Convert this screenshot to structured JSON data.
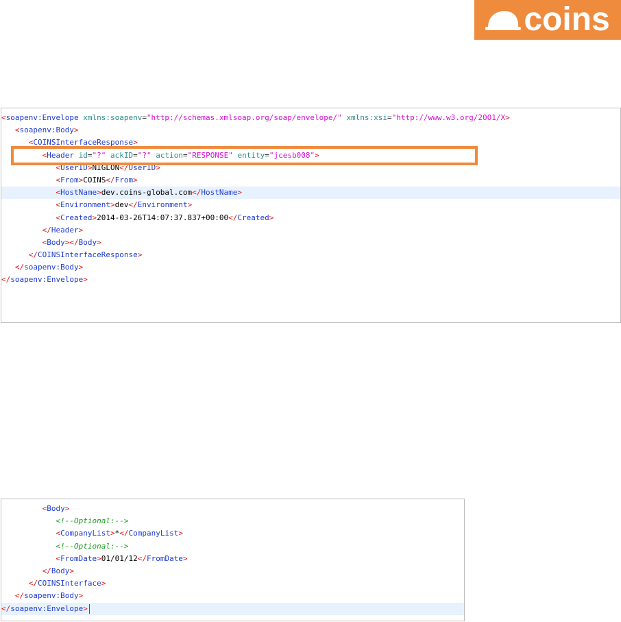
{
  "logo": {
    "text": "coins",
    "icon": "helmet-icon",
    "color": "#ef8b3d"
  },
  "top_panel": {
    "lines": [
      {
        "indent": "",
        "open": "soapenv:Envelope",
        "attrs": [
          [
            "xmlns:soapenv",
            "\"http://schemas.xmlsoap.org/soap/envelope/\""
          ],
          [
            "xmlns:xsi",
            "\"http://www.w3.org/2001/X"
          ]
        ]
      },
      {
        "indent": "   ",
        "open": "soapenv:Body"
      },
      {
        "indent": "      ",
        "open": "COINSInterfaceResponse"
      },
      {
        "indent": "         ",
        "open": "Header",
        "attrs": [
          [
            "id",
            "\"?\""
          ],
          [
            "ackID",
            "\"?\""
          ],
          [
            "action",
            "\"RESPONSE\""
          ],
          [
            "entity",
            "\"jcesb008\""
          ]
        ]
      },
      {
        "indent": "            ",
        "open": "UserID",
        "text": "NIGLON",
        "close": "UserID"
      },
      {
        "indent": "            ",
        "open": "From",
        "text": "COINS",
        "close": "From"
      },
      {
        "indent": "            ",
        "open": "HostName",
        "text": "dev.coins-global.com",
        "close": "HostName"
      },
      {
        "indent": "            ",
        "open": "Environment",
        "text": "dev",
        "close": "Environment"
      },
      {
        "indent": "            ",
        "open": "Created",
        "text": "2014-03-26T14:07:37.837+00:00",
        "close": "Created"
      },
      {
        "indent": "         ",
        "close": "Header"
      },
      {
        "indent": "         ",
        "open": "Body",
        "close": "Body"
      },
      {
        "indent": "      ",
        "close": "COINSInterfaceResponse"
      },
      {
        "indent": "   ",
        "close": "soapenv:Body"
      },
      {
        "indent": "",
        "close": "soapenv:Envelope"
      }
    ]
  },
  "bottom_panel": {
    "lines": [
      {
        "indent": "         ",
        "open": "Body"
      },
      {
        "indent": "            ",
        "comment": "<!--Optional:-->"
      },
      {
        "indent": "            ",
        "open": "CompanyList",
        "text": "*",
        "close": "CompanyList"
      },
      {
        "indent": "            ",
        "comment": "<!--Optional:-->"
      },
      {
        "indent": "            ",
        "open": "FromDate",
        "text": "01/01/12",
        "close": "FromDate"
      },
      {
        "indent": "         ",
        "close": "Body"
      },
      {
        "indent": "      ",
        "close": "COINSInterface"
      },
      {
        "indent": "   ",
        "close": "soapenv:Body"
      },
      {
        "indent": "",
        "close": "soapenv:Envelope"
      }
    ]
  }
}
